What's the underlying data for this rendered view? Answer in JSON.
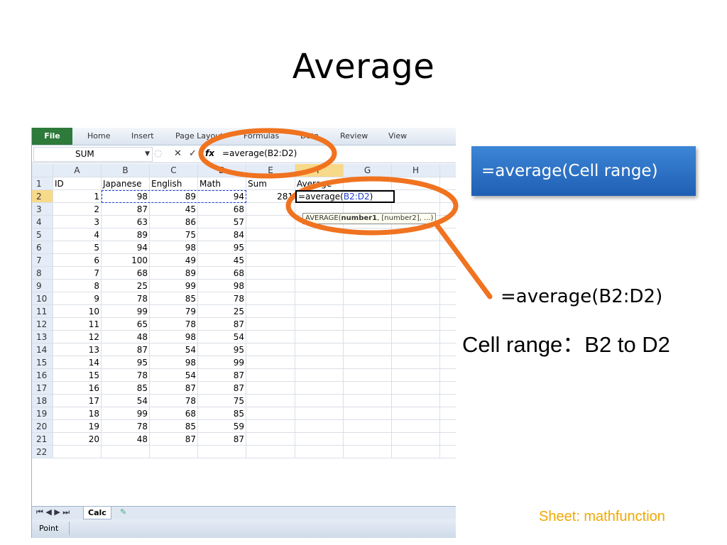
{
  "slide": {
    "title": "Average",
    "callout": "=average(Cell range)",
    "formula_example": "=average(B2:D2)",
    "cell_range_note": "Cell range：B2 to D2",
    "sheet_note": "Sheet: mathfunction"
  },
  "excel": {
    "ribbon_tabs": [
      "File",
      "Home",
      "Insert",
      "Page Layout",
      "Formulas",
      "Data",
      "Review",
      "View"
    ],
    "name_box": "SUM",
    "formula_bar_text": "=average(B2:D2)",
    "fx_label": "fx",
    "cancel_symbol": "✕",
    "enter_symbol": "✓",
    "column_headers": [
      "A",
      "B",
      "C",
      "D",
      "E",
      "F",
      "G",
      "H"
    ],
    "header_row": [
      "ID",
      "Japanese",
      "English",
      "Math",
      "Sum",
      "Average"
    ],
    "row_numbers": [
      "1",
      "2",
      "3",
      "4",
      "5",
      "6",
      "7",
      "8",
      "9",
      "10",
      "11",
      "12",
      "13",
      "14",
      "15",
      "16",
      "17",
      "18",
      "19",
      "20",
      "21",
      "22"
    ],
    "rows": [
      [
        "1",
        "98",
        "89",
        "94",
        "281"
      ],
      [
        "2",
        "87",
        "45",
        "68",
        ""
      ],
      [
        "3",
        "63",
        "86",
        "57",
        ""
      ],
      [
        "4",
        "89",
        "75",
        "84",
        ""
      ],
      [
        "5",
        "94",
        "98",
        "95",
        ""
      ],
      [
        "6",
        "100",
        "49",
        "45",
        ""
      ],
      [
        "7",
        "68",
        "89",
        "68",
        ""
      ],
      [
        "8",
        "25",
        "99",
        "98",
        ""
      ],
      [
        "9",
        "78",
        "85",
        "78",
        ""
      ],
      [
        "10",
        "99",
        "79",
        "25",
        ""
      ],
      [
        "11",
        "65",
        "78",
        "87",
        ""
      ],
      [
        "12",
        "48",
        "98",
        "54",
        ""
      ],
      [
        "13",
        "87",
        "54",
        "95",
        ""
      ],
      [
        "14",
        "95",
        "98",
        "99",
        ""
      ],
      [
        "15",
        "78",
        "54",
        "87",
        ""
      ],
      [
        "16",
        "85",
        "87",
        "87",
        ""
      ],
      [
        "17",
        "54",
        "78",
        "75",
        ""
      ],
      [
        "18",
        "99",
        "68",
        "85",
        ""
      ],
      [
        "19",
        "78",
        "85",
        "59",
        ""
      ],
      [
        "20",
        "48",
        "87",
        "87",
        ""
      ]
    ],
    "active_cell_formula_prefix": "=average(",
    "active_cell_formula_range": "B2:D2",
    "active_cell_formula_suffix": ")",
    "tooltip_fn": "AVERAGE(",
    "tooltip_arg1": "number1",
    "tooltip_rest": ", [number2], ...)",
    "sheet_tab": "Calc",
    "status": "Point"
  },
  "colors": {
    "highlight_orange": "#f07320",
    "range_blue": "#1f3fd0",
    "file_tab_green": "#2d7a3a",
    "callout_blue": "#2a6fc6"
  }
}
